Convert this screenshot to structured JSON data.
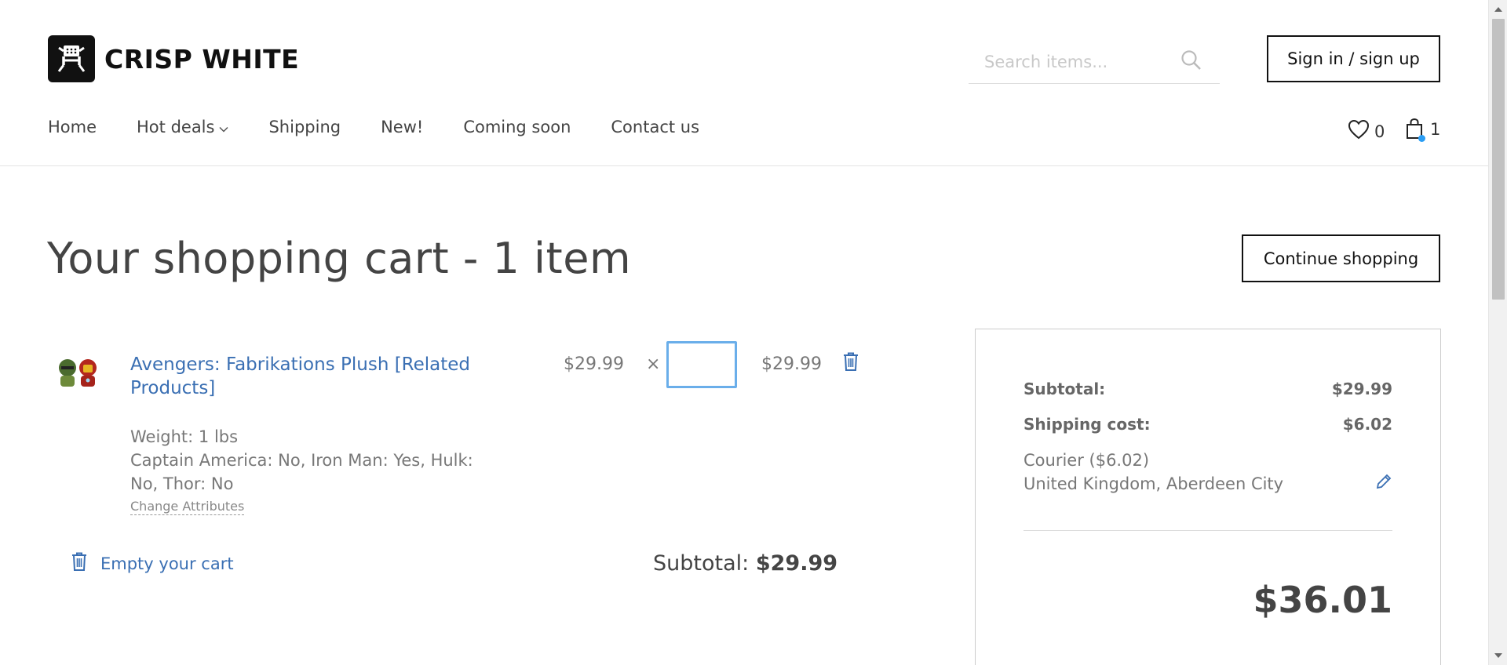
{
  "header": {
    "brand": "CRISP WHITE",
    "search_placeholder": "Search items...",
    "signin_label": "Sign in / sign up",
    "nav": [
      {
        "label": "Home"
      },
      {
        "label": "Hot deals",
        "has_dropdown": true
      },
      {
        "label": "Shipping"
      },
      {
        "label": "New!"
      },
      {
        "label": "Coming soon"
      },
      {
        "label": "Contact us"
      }
    ],
    "wishlist_count": "0",
    "cart_count": "1"
  },
  "main": {
    "title": "Your shopping cart - 1 item",
    "continue_label": "Continue shopping",
    "item": {
      "name": "Avengers: Fabrikations Plush [Related Products]",
      "price": "$29.99",
      "times": "×",
      "quantity": "",
      "total": "$29.99",
      "weight": "Weight: 1 lbs",
      "attributes": "Captain America: No, Iron Man: Yes, Hulk: No, Thor: No",
      "change_attributes_label": "Change Attributes"
    },
    "empty_cart_label": "Empty your cart",
    "subtotal_label": "Subtotal:",
    "subtotal_value": "$29.99"
  },
  "summary": {
    "subtotal_label": "Subtotal:",
    "subtotal_value": "$29.99",
    "shipping_label": "Shipping cost:",
    "shipping_value": "$6.02",
    "shipping_method": "Courier ($6.02)",
    "shipping_location": "United Kingdom, Aberdeen City",
    "total": "$36.01"
  },
  "colors": {
    "link": "#3a6fb3",
    "accent_dot": "#2a9df4",
    "focus": "#6aaeea"
  }
}
